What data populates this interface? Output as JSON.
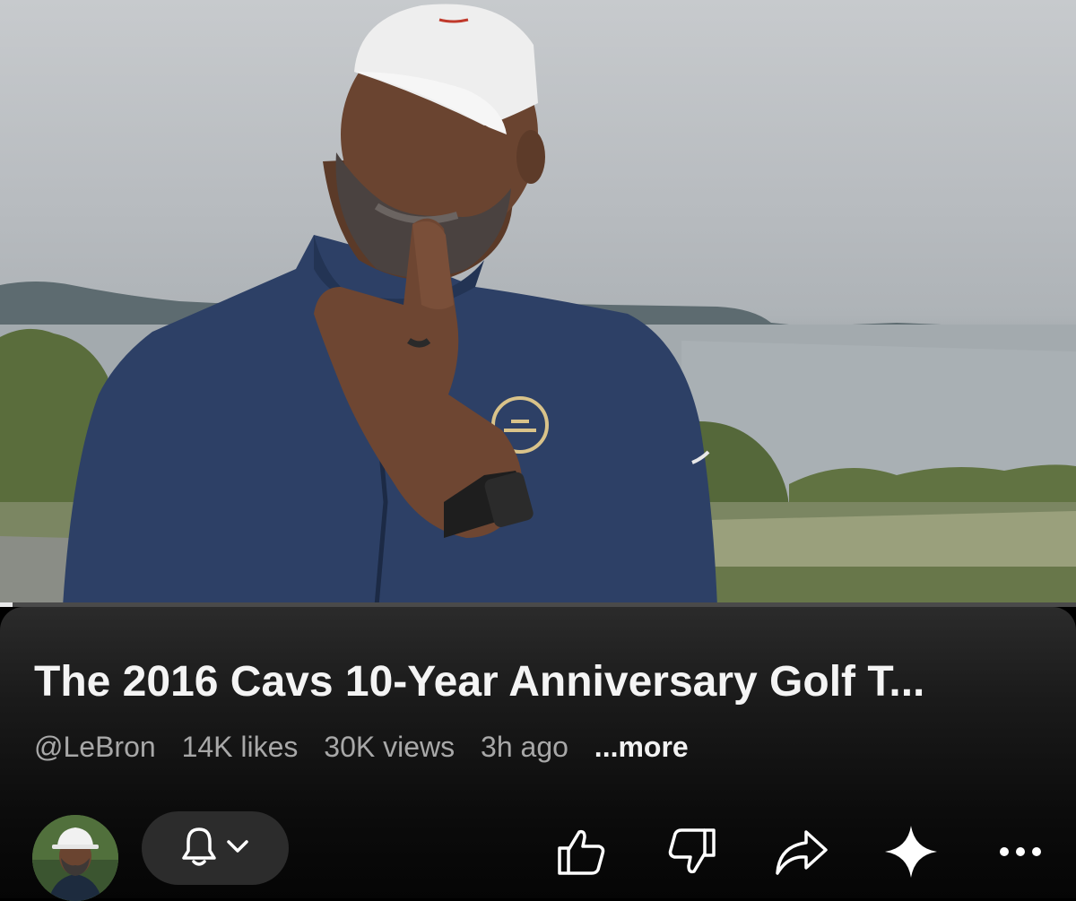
{
  "video": {
    "progress": 0.012
  },
  "info": {
    "title": "The 2016 Cavs 10-Year Anniversary Golf T...",
    "channel_handle": "@LeBron",
    "likes": "14K likes",
    "views": "30K views",
    "age": "3h ago",
    "more_label": "...more"
  },
  "actions": {
    "icons": [
      "bell-icon",
      "chevron-down-icon",
      "thumbs-up-icon",
      "thumbs-down-icon",
      "share-icon",
      "sparkle-icon",
      "more-horizontal-icon"
    ]
  },
  "colors": {
    "panel_background": "#1b1b1b",
    "pill_background": "#2c2c2c",
    "meta_text": "#a8a8a8",
    "title_text": "#f4f4f4"
  }
}
